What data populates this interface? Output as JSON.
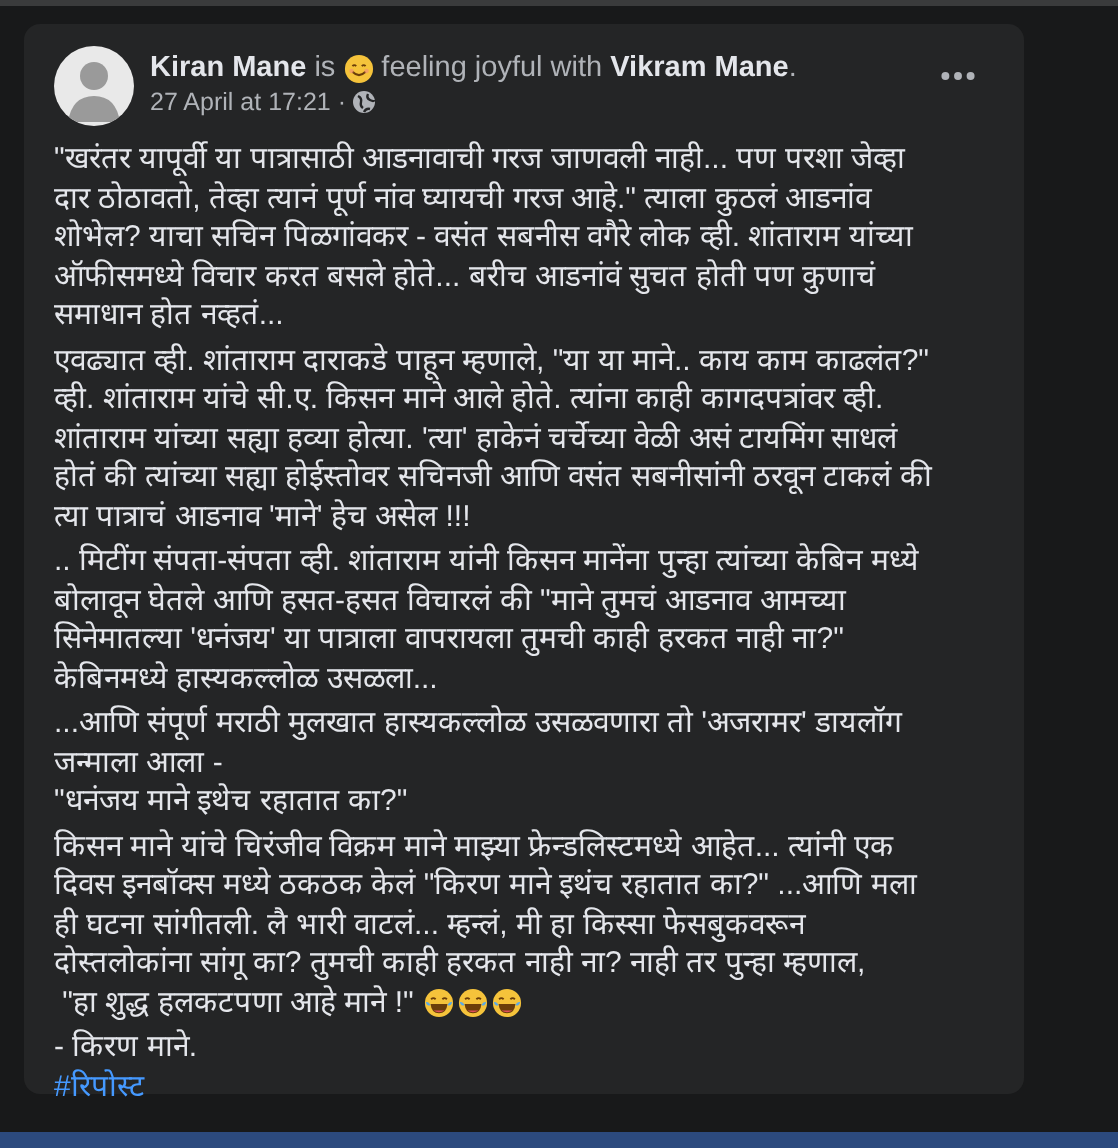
{
  "post": {
    "author": "Kiran Mane",
    "verb": "is",
    "feeling": "feeling joyful with",
    "tagged": "Vikram Mane",
    "tail": ".",
    "timestamp": "27 April at 17:21 ·",
    "paragraphs": [
      {
        "kind": "plain",
        "lines": [
          "\"खरंतर यापूर्वी या पात्रासाठी आडनावाची गरज जाणवली नाही... पण परशा जेव्हा",
          "दार ठोठावतो, तेव्हा त्यानं पूर्ण नांव घ्यायची गरज आहे.\" त्याला कुठलं आडनांव",
          "शोभेल? याचा सचिन पिळगांवकर - वसंत सबनीस वगैरे लोक व्ही. शांताराम यांच्या",
          "ऑफीसमध्ये विचार करत बसले होते... बरीच आडनांवं सुचत होती पण कुणाचं",
          "समाधान होत नव्हतं..."
        ]
      },
      {
        "kind": "plain",
        "lines": [
          "एवढ्यात व्ही. शांताराम दाराकडे पाहून म्हणाले, \"या या माने.. काय काम काढलंत?\"",
          "व्ही. शांताराम यांचे सी.ए. किसन माने आले होते. त्यांना काही कागदपत्रांवर व्ही.",
          "शांताराम यांच्या सह्या हव्या होत्या. 'त्या' हाकेनं चर्चेच्या वेळी असं टायमिंग साधलं",
          "होतं की त्यांच्या सह्या होईस्तोवर सचिनजी आणि वसंत सबनीसांनी ठरवून टाकलं की",
          "त्या पात्राचं आडनाव 'माने' हेच असेल !!!"
        ]
      },
      {
        "kind": "plain",
        "lines": [
          ".. मिटींग संपता-संपता व्ही. शांताराम यांनी किसन मानेंना पुन्हा त्यांच्या केबिन मध्ये",
          "बोलावून घेतले आणि हसत-हसत विचारलं की \"माने तुमचं आडनाव आमच्या",
          "सिनेमातल्या 'धनंजय' या पात्राला वापरायला तुमची काही हरकत नाही ना?\"",
          "केबिनमध्ये हास्यकल्लोळ उसळला..."
        ]
      },
      {
        "kind": "plain",
        "lines": [
          "...आणि संपूर्ण मराठी मुलखात हास्यकल्लोळ उसळवणारा तो 'अजरामर' डायलॉग",
          "जन्माला आला -",
          "\"धनंजय माने इथेच रहातात का?\""
        ]
      },
      {
        "kind": "laughing",
        "lines": [
          "किसन माने यांचे चिरंजीव विक्रम माने माझ्या फ्रेन्डलिस्टमध्ये आहेत... त्यांनी एक",
          "दिवस इनबॉक्स मध्ये ठकठक केलं \"किरण माने इथंच रहातात का?\" ...आणि मला",
          "ही घटना सांगीतली. लै भारी वाटलं... म्हन्लं, मी हा किस्सा फेसबुकवरून",
          "दोस्तलोकांना सांगू का? तुमची काही हरकत नाही ना? नाही तर पुन्हा म्हणाल,",
          " \"हा शुद्ध हलकटपणा आहे माने !\""
        ]
      },
      {
        "kind": "plain",
        "lines": [
          "- किरण माने."
        ]
      }
    ],
    "hashtag": "#रिपोस्ट"
  }
}
